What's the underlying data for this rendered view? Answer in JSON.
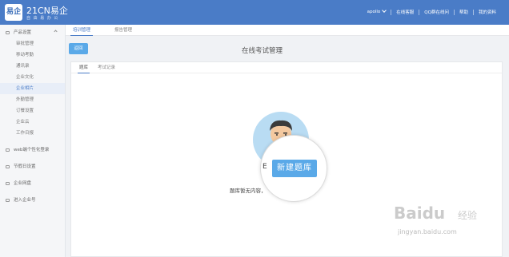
{
  "header": {
    "logo_text": "易企",
    "brand_title": "21CN易企",
    "brand_subtitle": "自 由 易 办 公",
    "user_name": "apollo",
    "nav_items": [
      "在线客服",
      "QQ群在线问",
      "帮助",
      "我的资料"
    ]
  },
  "sidebar": {
    "group_product": "产品设置",
    "items": [
      "审批管理",
      "移动考勤",
      "通讯录",
      "企业文化",
      "企业相片",
      "外勤管理",
      "订餐设置",
      "企业云",
      "工作日报"
    ],
    "active_index": 4,
    "lower_groups": [
      "web端个性化登录",
      "节假日设置",
      "企业网盘",
      "进入企业号"
    ]
  },
  "tabs": {
    "items": [
      "培训管理",
      "报告管理"
    ],
    "active_index": 0
  },
  "main": {
    "back_label": "返回",
    "page_title": "在线考试管理",
    "sub_tabs": [
      "题库",
      "考试记录"
    ],
    "empty_text": "题库暂无内容，",
    "magnifier_partial": "E",
    "new_button_label": "新建题库"
  },
  "watermark": {
    "brand": "Baidu",
    "subtitle": "经验",
    "url": "jingyan.baidu.com"
  },
  "colors": {
    "header_bg": "#4a7cc7",
    "accent": "#5aa9e8"
  }
}
